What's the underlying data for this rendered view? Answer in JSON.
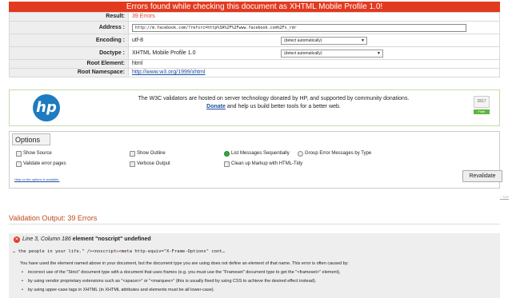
{
  "banner": "Errors found while checking this document as XHTML Mobile Profile 1.0!",
  "result": {
    "result_label": "Result:",
    "result_value": "39 Errors",
    "address_label": "Address :",
    "address_value": "http://m.facebook.com/?refsrc=http%3A%2F%2Fwww.facebook.com%2Fs_rdr",
    "encoding_label": "Encoding :",
    "encoding_value": "utf-8",
    "encoding_select": "(detect automatically)",
    "doctype_label": "Doctype :",
    "doctype_value": "XHTML Mobile Profile 1.0",
    "doctype_select": "(detect automatically)",
    "root_label": "Root Element:",
    "root_value": "html",
    "ns_label": "Root Namespace:",
    "ns_value": "http://www.w3.org/1999/xhtml"
  },
  "sponsor": {
    "logo": "hp",
    "line1": "The W3C validators are hosted on server technology donated by HP, and supported by community donations.",
    "donate": "Donate",
    "line2": " and help us build better tools for a better web.",
    "flattr_count": "2817",
    "flattr_label": "Flattr"
  },
  "options": {
    "title": "Options",
    "show_source": "Show Source",
    "show_outline": "Show Outline",
    "list_seq": "List Messages Sequentially",
    "group_err": "Group Error Messages by Type",
    "validate_err": "Validate error pages",
    "verbose": "Verbose Output",
    "cleanup": "Clean up Markup with HTML-Tidy",
    "help": "Help on the options is available.",
    "revalidate": "Revalidate"
  },
  "top_link": "↑ TOP",
  "output": {
    "title": "Validation Output: 39 Errors",
    "error": {
      "location": "Line 3, Column 186",
      "message": "element \"noscript\" undefined",
      "snippet_pre": "… the people in your life.\" /><noscript",
      "snippet_mark": "✉",
      "snippet_post": "<meta http-equiv=\"X-Frame-Options\" cont…",
      "explanation": "You have used the element named above in your document, but the document type you are using does not define an element of that name. This error is often caused by:",
      "bullets": [
        "incorrect use of the \"Strict\" document type with a document that uses frames (e.g. you must use the \"Frameset\" document type to get the \"<frameset>\" element),",
        "by using vendor proprietary extensions such as \"<spacer>\" or \"<marquee>\" (this is usually fixed by using CSS to achieve the desired effect instead).",
        "by using upper-case tags in XHTML (in XHTML attributes and elements must be all lower-case)."
      ]
    }
  },
  "colors": {
    "banner": "#e23a1f",
    "link": "#1a4fa0",
    "radio_on": "#39a83a"
  }
}
